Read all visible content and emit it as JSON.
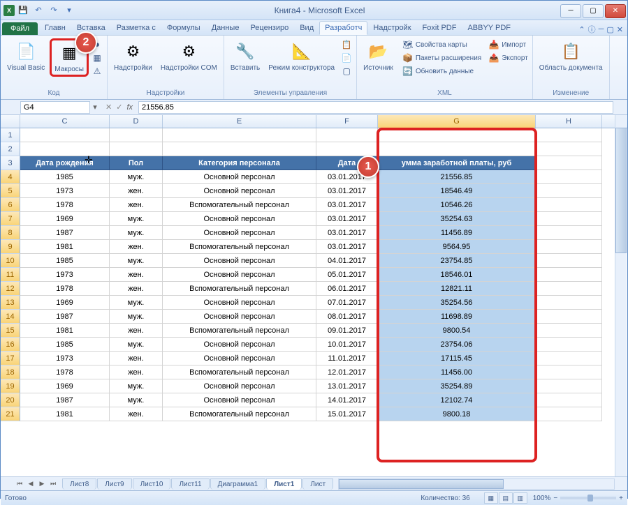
{
  "window": {
    "title": "Книга4 - Microsoft Excel"
  },
  "ribbon": {
    "file_label": "Файл",
    "tabs": [
      "Главн",
      "Вставка",
      "Разметка с",
      "Формулы",
      "Данные",
      "Рецензиро",
      "Вид",
      "Разработч",
      "Надстройк",
      "Foxit PDF",
      "ABBYY PDF"
    ],
    "active_tab": "Разработч",
    "groups": {
      "code": {
        "label": "Код",
        "visual_basic": "Visual\nBasic",
        "macros": "Макросы"
      },
      "addins": {
        "label": "Надстройки",
        "addins": "Надстройки",
        "com": "Надстройки\nCOM"
      },
      "controls": {
        "label": "Элементы управления",
        "insert": "Вставить",
        "design": "Режим\nконструктора"
      },
      "xml": {
        "label": "XML",
        "source": "Источник",
        "props": "Свойства карты",
        "packs": "Пакеты расширения",
        "refresh": "Обновить данные",
        "import": "Импорт",
        "export": "Экспорт"
      },
      "modify": {
        "label": "Изменение",
        "docpanel": "Область\nдокумента"
      }
    }
  },
  "formula_bar": {
    "name_box": "G4",
    "value": "21556.85"
  },
  "columns": [
    "C",
    "D",
    "E",
    "F",
    "G",
    "H"
  ],
  "headers": {
    "C": "Дата рождения",
    "D": "Пол",
    "E": "Категория персонала",
    "F": "Дата",
    "G": "умма заработной платы, руб"
  },
  "rows": [
    {
      "n": 4,
      "C": "1985",
      "D": "муж.",
      "E": "Основной персонал",
      "F": "03.01.2017",
      "G": "21556.85"
    },
    {
      "n": 5,
      "C": "1973",
      "D": "жен.",
      "E": "Основной персонал",
      "F": "03.01.2017",
      "G": "18546.49"
    },
    {
      "n": 6,
      "C": "1978",
      "D": "жен.",
      "E": "Вспомогательный персонал",
      "F": "03.01.2017",
      "G": "10546.26"
    },
    {
      "n": 7,
      "C": "1969",
      "D": "муж.",
      "E": "Основной персонал",
      "F": "03.01.2017",
      "G": "35254.63"
    },
    {
      "n": 8,
      "C": "1987",
      "D": "муж.",
      "E": "Основной персонал",
      "F": "03.01.2017",
      "G": "11456.89"
    },
    {
      "n": 9,
      "C": "1981",
      "D": "жен.",
      "E": "Вспомогательный персонал",
      "F": "03.01.2017",
      "G": "9564.95"
    },
    {
      "n": 10,
      "C": "1985",
      "D": "муж.",
      "E": "Основной персонал",
      "F": "04.01.2017",
      "G": "23754.85"
    },
    {
      "n": 11,
      "C": "1973",
      "D": "жен.",
      "E": "Основной персонал",
      "F": "05.01.2017",
      "G": "18546.01"
    },
    {
      "n": 12,
      "C": "1978",
      "D": "жен.",
      "E": "Вспомогательный персонал",
      "F": "06.01.2017",
      "G": "12821.11"
    },
    {
      "n": 13,
      "C": "1969",
      "D": "муж.",
      "E": "Основной персонал",
      "F": "07.01.2017",
      "G": "35254.56"
    },
    {
      "n": 14,
      "C": "1987",
      "D": "муж.",
      "E": "Основной персонал",
      "F": "08.01.2017",
      "G": "11698.89"
    },
    {
      "n": 15,
      "C": "1981",
      "D": "жен.",
      "E": "Вспомогательный персонал",
      "F": "09.01.2017",
      "G": "9800.54"
    },
    {
      "n": 16,
      "C": "1985",
      "D": "муж.",
      "E": "Основной персонал",
      "F": "10.01.2017",
      "G": "23754.06"
    },
    {
      "n": 17,
      "C": "1973",
      "D": "жен.",
      "E": "Основной персонал",
      "F": "11.01.2017",
      "G": "17115.45"
    },
    {
      "n": 18,
      "C": "1978",
      "D": "жен.",
      "E": "Вспомогательный персонал",
      "F": "12.01.2017",
      "G": "11456.00"
    },
    {
      "n": 19,
      "C": "1969",
      "D": "муж.",
      "E": "Основной персонал",
      "F": "13.01.2017",
      "G": "35254.89"
    },
    {
      "n": 20,
      "C": "1987",
      "D": "муж.",
      "E": "Основной персонал",
      "F": "14.01.2017",
      "G": "12102.74"
    },
    {
      "n": 21,
      "C": "1981",
      "D": "жен.",
      "E": "Вспомогательный персонал",
      "F": "15.01.2017",
      "G": "9800.18"
    }
  ],
  "sheet_tabs": [
    "Лист8",
    "Лист9",
    "Лист10",
    "Лист11",
    "Диаграмма1",
    "Лист1",
    "Лист"
  ],
  "active_sheet": "Лист1",
  "statusbar": {
    "ready": "Готово",
    "count_label": "Количество: 36",
    "zoom": "100%"
  },
  "callouts": {
    "c1": "1",
    "c2": "2"
  }
}
